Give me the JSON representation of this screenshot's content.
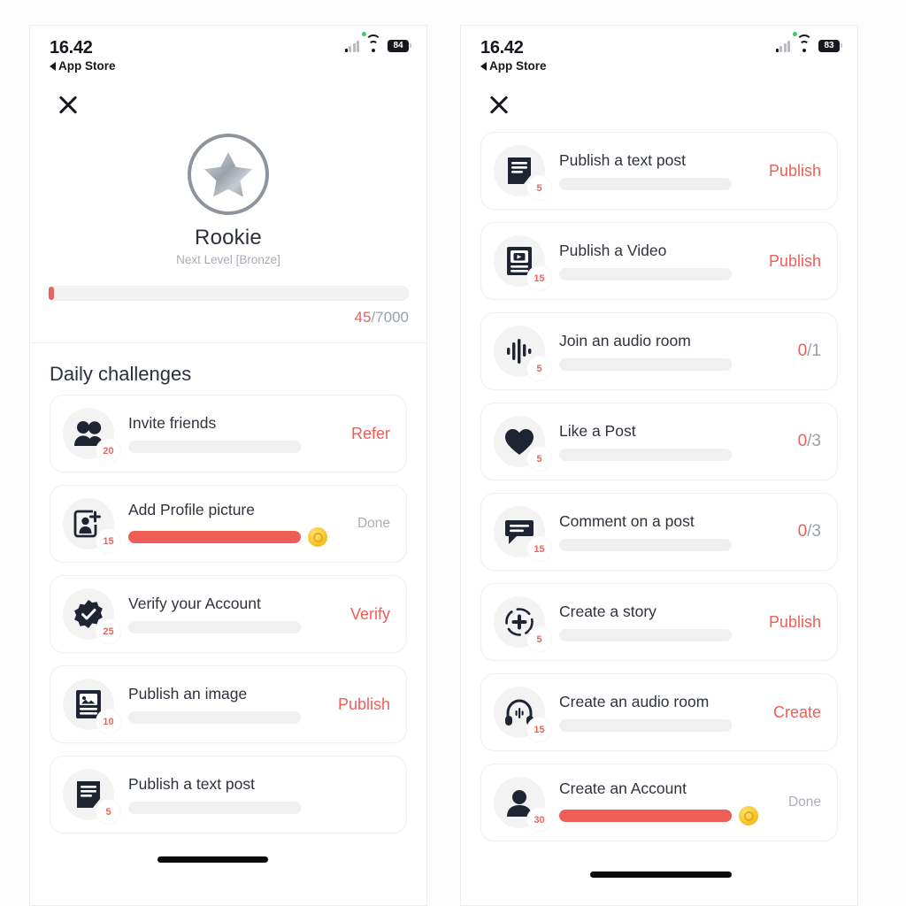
{
  "status_bar_left": {
    "time": "16.42",
    "back_label": "App Store",
    "battery": "84",
    "icons": [
      "green-dot-icon",
      "cellular-signal-icon",
      "wifi-icon",
      "battery-icon"
    ]
  },
  "status_bar_right": {
    "time": "16.42",
    "back_label": "App Store",
    "battery": "83",
    "icons": [
      "green-dot-icon",
      "cellular-signal-icon",
      "wifi-icon",
      "battery-icon"
    ]
  },
  "colors": {
    "accent": "#ef5d57",
    "text_dark": "#2e333c",
    "text_muted": "#a7acb4",
    "icon_glyph": "#1f2433",
    "icon_circle": "#f3f3f4",
    "track": "#f0f0f1",
    "coin_gold": "#f6c62c"
  },
  "rank": {
    "badge_icon": "star-badge-icon",
    "title": "Rookie",
    "next_level": "Next Level [Bronze]",
    "xp_current": "45",
    "xp_separator": "/",
    "xp_goal": "7000",
    "xp_label": "45/7000",
    "progress_percent": 0.64
  },
  "daily_challenges": {
    "section_title": "Daily challenges",
    "items": [
      {
        "title": "Invite friends",
        "points": "20",
        "icon": "two-people-icon",
        "action": "Refer",
        "action_type": "link",
        "progress": "empty"
      },
      {
        "title": "Add Profile picture",
        "points": "15",
        "icon": "add-profile-picture-icon",
        "action": "Done",
        "action_type": "done",
        "progress": "full",
        "coin": true
      },
      {
        "title": "Verify your Account",
        "points": "25",
        "icon": "verified-badge-icon",
        "action": "Verify",
        "action_type": "link",
        "progress": "empty"
      },
      {
        "title": "Publish an image",
        "points": "10",
        "icon": "image-post-icon",
        "action": "Publish",
        "action_type": "link",
        "progress": "empty"
      },
      {
        "title": "Publish a text post",
        "points": "5",
        "icon": "text-post-icon",
        "action": "",
        "action_type": "cut-off",
        "progress": "empty"
      }
    ]
  },
  "challenges_right": {
    "items": [
      {
        "title": "Publish a text post",
        "points": "5",
        "icon": "text-post-icon",
        "action": "Publish",
        "action_type": "link",
        "progress": "empty"
      },
      {
        "title": "Publish a Video",
        "points": "15",
        "icon": "video-post-icon",
        "action": "Publish",
        "action_type": "link",
        "progress": "empty"
      },
      {
        "title": "Join an audio room",
        "points": "5",
        "icon": "audio-wave-icon",
        "action": "0/1",
        "action_type": "count",
        "count_current": "0",
        "count_total": "/1",
        "progress": "empty"
      },
      {
        "title": "Like a Post",
        "points": "5",
        "icon": "heart-icon",
        "action": "0/3",
        "action_type": "count",
        "count_current": "0",
        "count_total": "/3",
        "progress": "empty"
      },
      {
        "title": "Comment on a post",
        "points": "15",
        "icon": "comment-bubble-icon",
        "action": "0/3",
        "action_type": "count",
        "count_current": "0",
        "count_total": "/3",
        "progress": "empty"
      },
      {
        "title": "Create a story",
        "points": "5",
        "icon": "create-story-plus-icon",
        "action": "Publish",
        "action_type": "link",
        "progress": "empty"
      },
      {
        "title": "Create an audio room",
        "points": "15",
        "icon": "headphones-icon",
        "action": "Create",
        "action_type": "link",
        "progress": "empty"
      },
      {
        "title": "Create an Account",
        "points": "30",
        "icon": "user-avatar-icon",
        "action": "Done",
        "action_type": "done",
        "progress": "full",
        "coin": true
      }
    ]
  }
}
